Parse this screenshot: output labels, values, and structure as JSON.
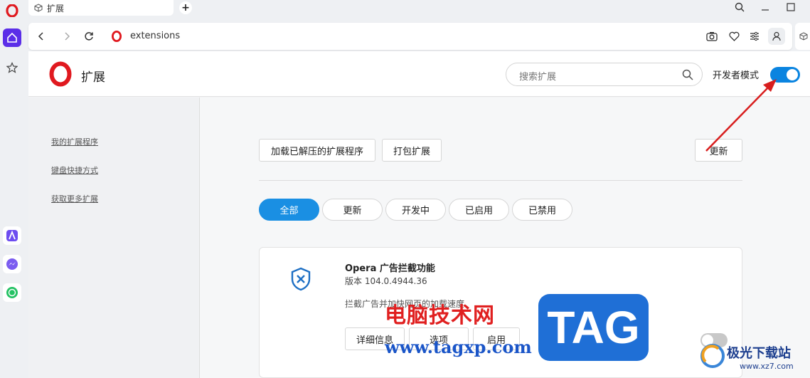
{
  "tab": {
    "title": "扩展"
  },
  "addressbar": {
    "url": "extensions"
  },
  "header": {
    "title": "扩展",
    "search_placeholder": "搜索扩展",
    "developer_mode_label": "开发者模式",
    "developer_mode_on": true
  },
  "sidebar_nav": {
    "items": [
      "我的扩展程序",
      "键盘快捷方式",
      "获取更多扩展"
    ]
  },
  "toolbar": {
    "load_unpacked": "加载已解压的扩展程序",
    "pack": "打包扩展",
    "update": "更新"
  },
  "filters": [
    "全部",
    "更新",
    "开发中",
    "已启用",
    "已禁用"
  ],
  "active_filter": "全部",
  "extension": {
    "name": "Opera 广告拦截功能",
    "version": "版本 104.0.4944.36",
    "description": "拦截广告并加快网页的加载速度",
    "buttons": [
      "详细信息",
      "选项",
      "启用"
    ],
    "enabled": false
  },
  "watermarks": {
    "site_cn": "电脑技术网",
    "site_url": "www.tagxp.com",
    "tag": "TAG",
    "xz_cn": "极光下载站",
    "xz_url": "www.xz7.com"
  },
  "colors": {
    "accent": "#1a8fe3",
    "opera_red": "#e0191f",
    "annotation_arrow": "#d81e1e"
  }
}
